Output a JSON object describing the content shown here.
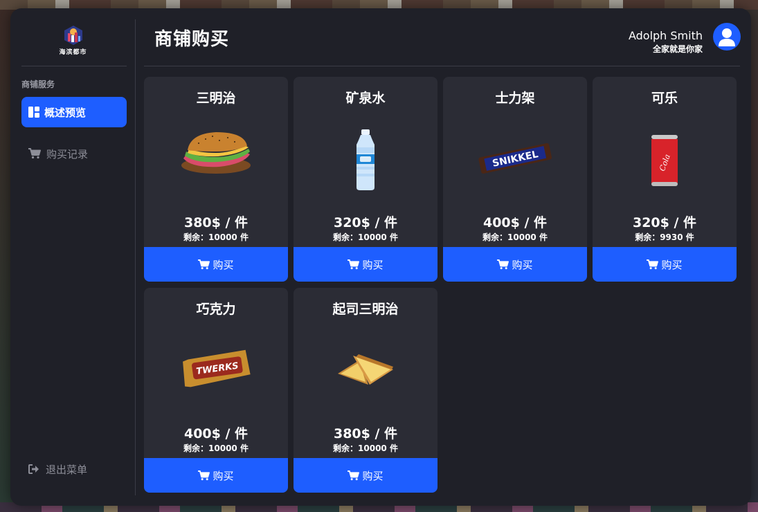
{
  "app": {
    "logo_text": "海滨都市",
    "page_title": "商铺购买"
  },
  "user": {
    "name": "Adolph Smith",
    "subtitle": "全家就是你家"
  },
  "sidebar": {
    "section_label": "商铺服务",
    "items": [
      {
        "label": "概述预览",
        "icon": "dashboard-icon",
        "active": true
      },
      {
        "label": "购买记录",
        "icon": "cart-icon",
        "active": false
      }
    ],
    "exit_label": "退出菜单",
    "exit_icon": "sign-out-icon"
  },
  "products": [
    {
      "name": "三明治",
      "price": "380$ / 件",
      "stock": "剩余：10000 件",
      "image": "sandwich",
      "buy_label": "购买"
    },
    {
      "name": "矿泉水",
      "price": "320$ / 件",
      "stock": "剩余：10000 件",
      "image": "water-bottle",
      "buy_label": "购买"
    },
    {
      "name": "士力架",
      "price": "400$ / 件",
      "stock": "剩余：10000 件",
      "image": "snikkel-bar",
      "image_text": "SNIKKEL",
      "buy_label": "购买"
    },
    {
      "name": "可乐",
      "price": "320$ / 件",
      "stock": "剩余：9930 件",
      "image": "cola-can",
      "image_text": "Cola",
      "buy_label": "购买"
    },
    {
      "name": "巧克力",
      "price": "400$ / 件",
      "stock": "剩余：10000 件",
      "image": "twerks-bar",
      "image_text": "TWERKS",
      "buy_label": "购买"
    },
    {
      "name": "起司三明治",
      "price": "380$ / 件",
      "stock": "剩余：10000 件",
      "image": "grilled-cheese",
      "buy_label": "购买"
    }
  ],
  "colors": {
    "accent": "#1e5eff",
    "panel_bg": "#1f2028",
    "card_bg": "#2b2c35"
  }
}
